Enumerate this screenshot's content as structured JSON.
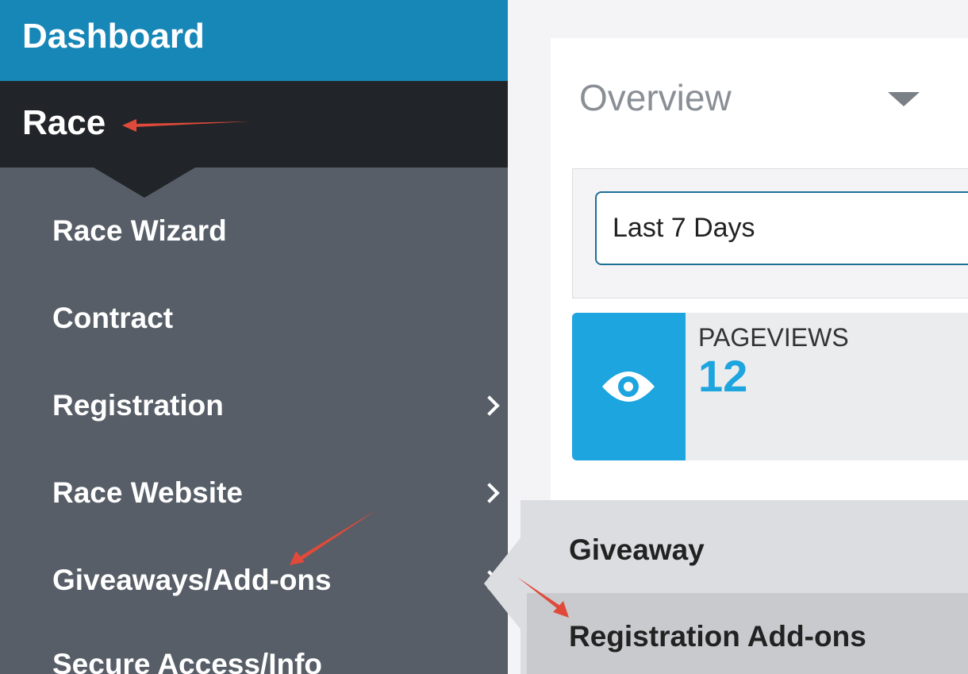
{
  "sidebar": {
    "dashboard_label": "Dashboard",
    "race_label": "Race",
    "items": [
      {
        "label": "Race Wizard",
        "has_submenu": false
      },
      {
        "label": "Contract",
        "has_submenu": false
      },
      {
        "label": "Registration",
        "has_submenu": true
      },
      {
        "label": "Race Website",
        "has_submenu": true
      },
      {
        "label": "Giveaways/Add-ons",
        "has_submenu": true
      },
      {
        "label": "Secure Access/Info",
        "has_submenu": false
      }
    ]
  },
  "overview": {
    "title": "Overview",
    "date_range": "Last 7 Days",
    "pageviews_label": "PAGEVIEWS",
    "pageviews_value": "12",
    "icon": "eye-icon"
  },
  "flyout": {
    "items": [
      {
        "label": "Giveaway"
      },
      {
        "label": "Registration Add-ons"
      }
    ]
  },
  "colors": {
    "dashboard_bg": "#1787b7",
    "race_bg": "#212529",
    "sidebar_bg": "#575e67",
    "accent_blue": "#1ca5df",
    "annotation_arrow": "#e04a3a"
  }
}
